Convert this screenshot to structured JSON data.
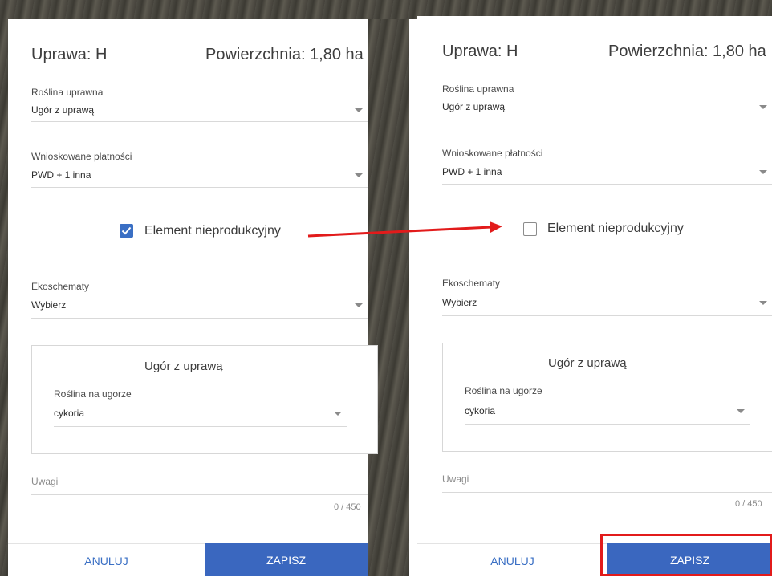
{
  "left_form": {
    "title": "Uprawa: H",
    "area": "Powierzchnia: 1,80 ha",
    "crop": {
      "label": "Roślina uprawna",
      "value": "Ugór z uprawą"
    },
    "payments": {
      "label": "Wnioskowane płatności",
      "value": "PWD + 1 inna"
    },
    "nonproductive": {
      "label": "Element nieprodukcyjny",
      "checked": true
    },
    "ecoschemes": {
      "label": "Ekoschematy",
      "value": "Wybierz"
    },
    "fallow": {
      "title": "Ugór z uprawą",
      "plant_label": "Roślina na ugorze",
      "plant_value": "cykoria"
    },
    "notes": {
      "label": "Uwagi",
      "counter": "0 / 450"
    },
    "cancel_label": "ANULUJ",
    "save_label": "ZAPISZ"
  },
  "right_form": {
    "title": "Uprawa: H",
    "area": "Powierzchnia: 1,80 ha",
    "crop": {
      "label": "Roślina uprawna",
      "value": "Ugór z uprawą"
    },
    "payments": {
      "label": "Wnioskowane płatności",
      "value": "PWD + 1 inna"
    },
    "nonproductive": {
      "label": "Element nieprodukcyjny",
      "checked": false
    },
    "ecoschemes": {
      "label": "Ekoschematy",
      "value": "Wybierz"
    },
    "fallow": {
      "title": "Ugór z uprawą",
      "plant_label": "Roślina na ugorze",
      "plant_value": "cykoria"
    },
    "notes": {
      "label": "Uwagi",
      "counter": "0 / 450"
    },
    "cancel_label": "ANULUJ",
    "save_label": "ZAPISZ"
  },
  "colors": {
    "accent": "#3a67bf",
    "annotation": "#e21b1b"
  },
  "icons": [
    "checkbox-checked-icon",
    "checkbox-empty-icon",
    "dropdown-caret-icon",
    "annotation-arrow-icon"
  ]
}
